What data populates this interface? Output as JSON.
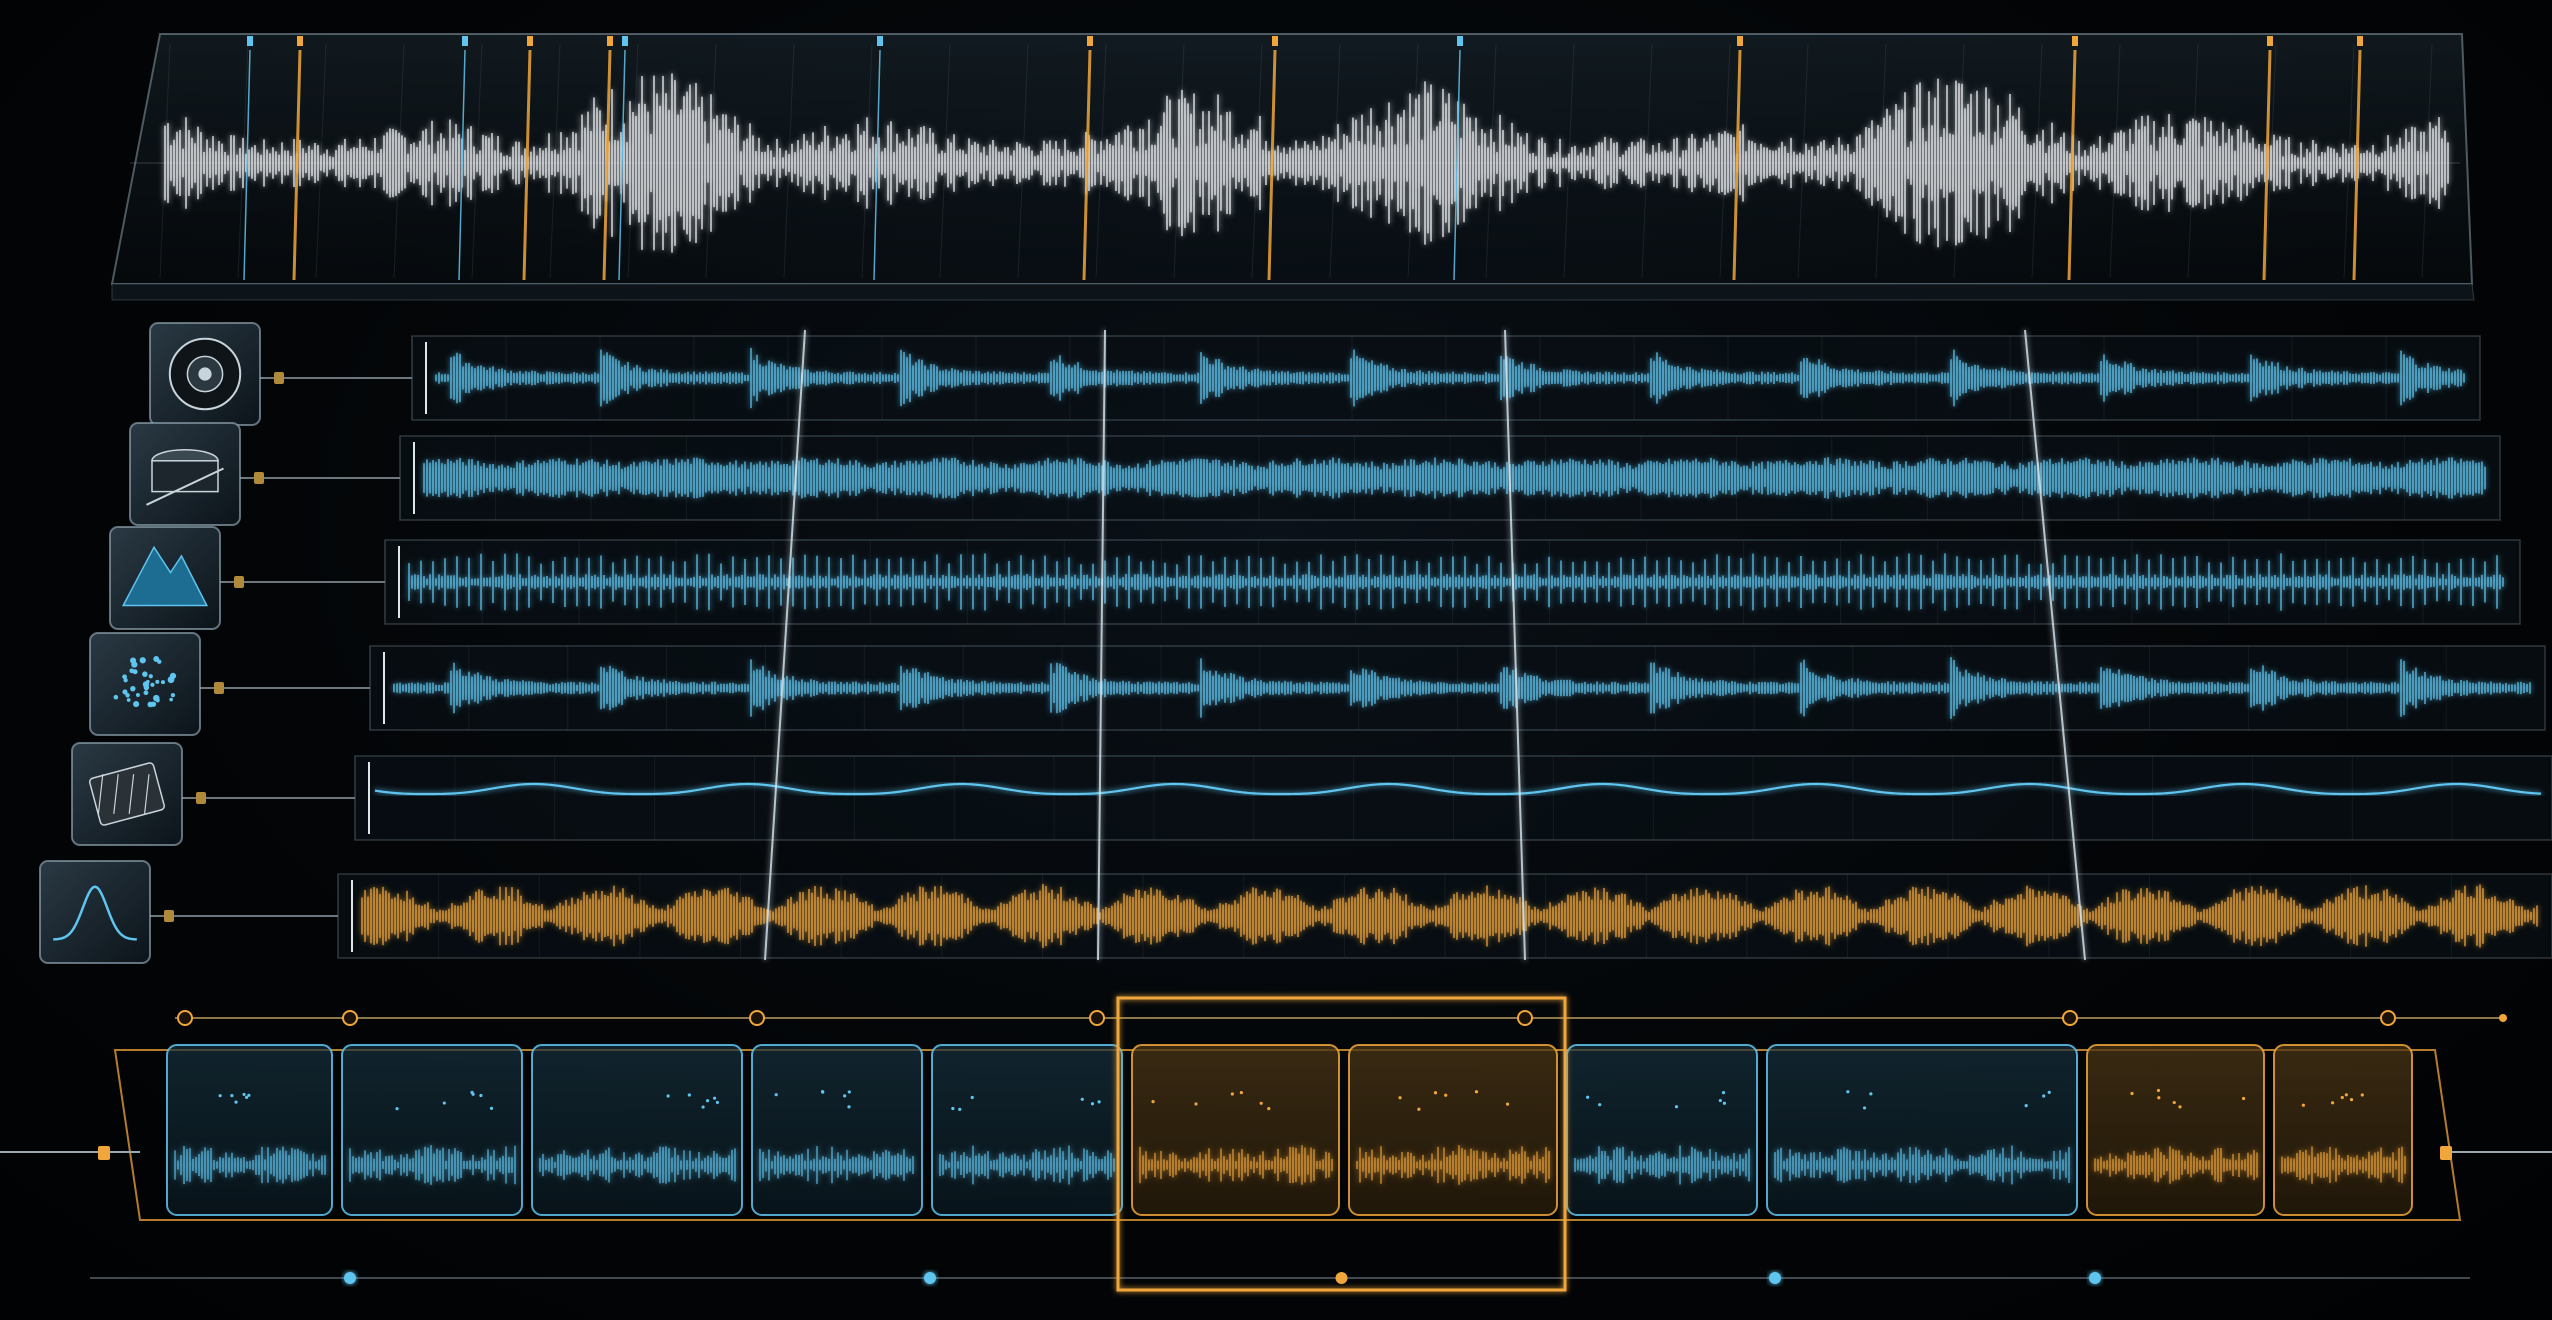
{
  "scene": {
    "background_color": "#020304",
    "accent_blue": "#5fc4ee",
    "accent_amber": "#f0a63a",
    "waveform_white": "#e6e9ec"
  },
  "master_track": {
    "waveform_color": "#e6e9ec",
    "marker_colors": [
      "#5fc4ee",
      "#f0a63a"
    ]
  },
  "tracks": [
    {
      "id": "track-speaker",
      "icon": "speaker-icon",
      "waveform_color": "#5fc4ee",
      "style": "bursts"
    },
    {
      "id": "track-drum",
      "icon": "drum-icon",
      "waveform_color": "#5fc4ee",
      "style": "dense"
    },
    {
      "id": "track-mountain",
      "icon": "mountain-icon",
      "waveform_color": "#5fc4ee",
      "style": "spikes"
    },
    {
      "id": "track-particles",
      "icon": "particles-icon",
      "waveform_color": "#5fc4ee",
      "style": "bursts"
    },
    {
      "id": "track-circuit",
      "icon": "circuit-icon",
      "waveform_color": "#5fc4ee",
      "style": "smooth"
    },
    {
      "id": "track-gaussian",
      "icon": "gaussian-curve-icon",
      "waveform_color": "#f0a63a",
      "style": "amber"
    }
  ],
  "segments": [
    {
      "tone": "blue"
    },
    {
      "tone": "blue"
    },
    {
      "tone": "blue"
    },
    {
      "tone": "blue"
    },
    {
      "tone": "blue"
    },
    {
      "tone": "amber"
    },
    {
      "tone": "amber"
    },
    {
      "tone": "blue"
    },
    {
      "tone": "blue"
    },
    {
      "tone": "amber"
    },
    {
      "tone": "amber"
    }
  ],
  "selection": {
    "tone": "amber",
    "first_segment": 5,
    "last_segment": 6
  }
}
